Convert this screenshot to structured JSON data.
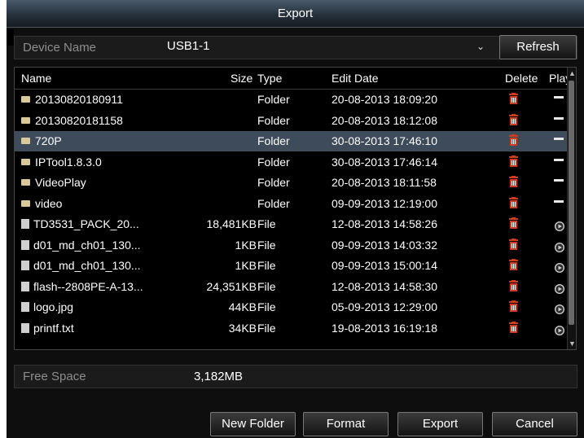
{
  "dialog": {
    "title": "Export"
  },
  "device": {
    "label": "Device Name",
    "selected": "USB1-1",
    "refresh_label": "Refresh"
  },
  "table": {
    "headers": {
      "name": "Name",
      "size": "Size",
      "type": "Type",
      "date": "Edit Date",
      "delete": "Delete",
      "play": "Play"
    },
    "rows": [
      {
        "name": "20130820180911",
        "size": "",
        "type": "Folder",
        "date": "20-08-2013 18:09:20",
        "kind": "folder"
      },
      {
        "name": "20130820181158",
        "size": "",
        "type": "Folder",
        "date": "20-08-2013 18:12:08",
        "kind": "folder"
      },
      {
        "name": "720P",
        "size": "",
        "type": "Folder",
        "date": "30-08-2013 17:46:10",
        "kind": "folder",
        "selected": true
      },
      {
        "name": "IPTool1.8.3.0",
        "size": "",
        "type": "Folder",
        "date": "30-08-2013 17:46:14",
        "kind": "folder"
      },
      {
        "name": "VideoPlay",
        "size": "",
        "type": "Folder",
        "date": "20-08-2013 18:11:58",
        "kind": "folder"
      },
      {
        "name": "video",
        "size": "",
        "type": "Folder",
        "date": "09-09-2013 12:19:00",
        "kind": "folder"
      },
      {
        "name": "TD3531_PACK_20...",
        "size": "18,481KB",
        "type": "File",
        "date": "12-08-2013 14:58:26",
        "kind": "file"
      },
      {
        "name": "d01_md_ch01_130...",
        "size": "1KB",
        "type": "File",
        "date": "09-09-2013 14:03:32",
        "kind": "file"
      },
      {
        "name": "d01_md_ch01_130...",
        "size": "1KB",
        "type": "File",
        "date": "09-09-2013 15:00:14",
        "kind": "file"
      },
      {
        "name": "flash--2808PE-A-13...",
        "size": "24,351KB",
        "type": "File",
        "date": "12-08-2013 14:58:30",
        "kind": "file"
      },
      {
        "name": "logo.jpg",
        "size": "44KB",
        "type": "File",
        "date": "05-09-2013 12:29:00",
        "kind": "file"
      },
      {
        "name": "printf.txt",
        "size": "34KB",
        "type": "File",
        "date": "19-08-2013 16:19:18",
        "kind": "file"
      }
    ]
  },
  "free_space": {
    "label": "Free Space",
    "value": "3,182MB"
  },
  "buttons": {
    "new_folder": "New Folder",
    "format": "Format",
    "export": "Export",
    "cancel": "Cancel"
  },
  "colors": {
    "trash": "#d43b1c",
    "selected_row": "#3d4b5b",
    "title_bar": "#26313c"
  }
}
